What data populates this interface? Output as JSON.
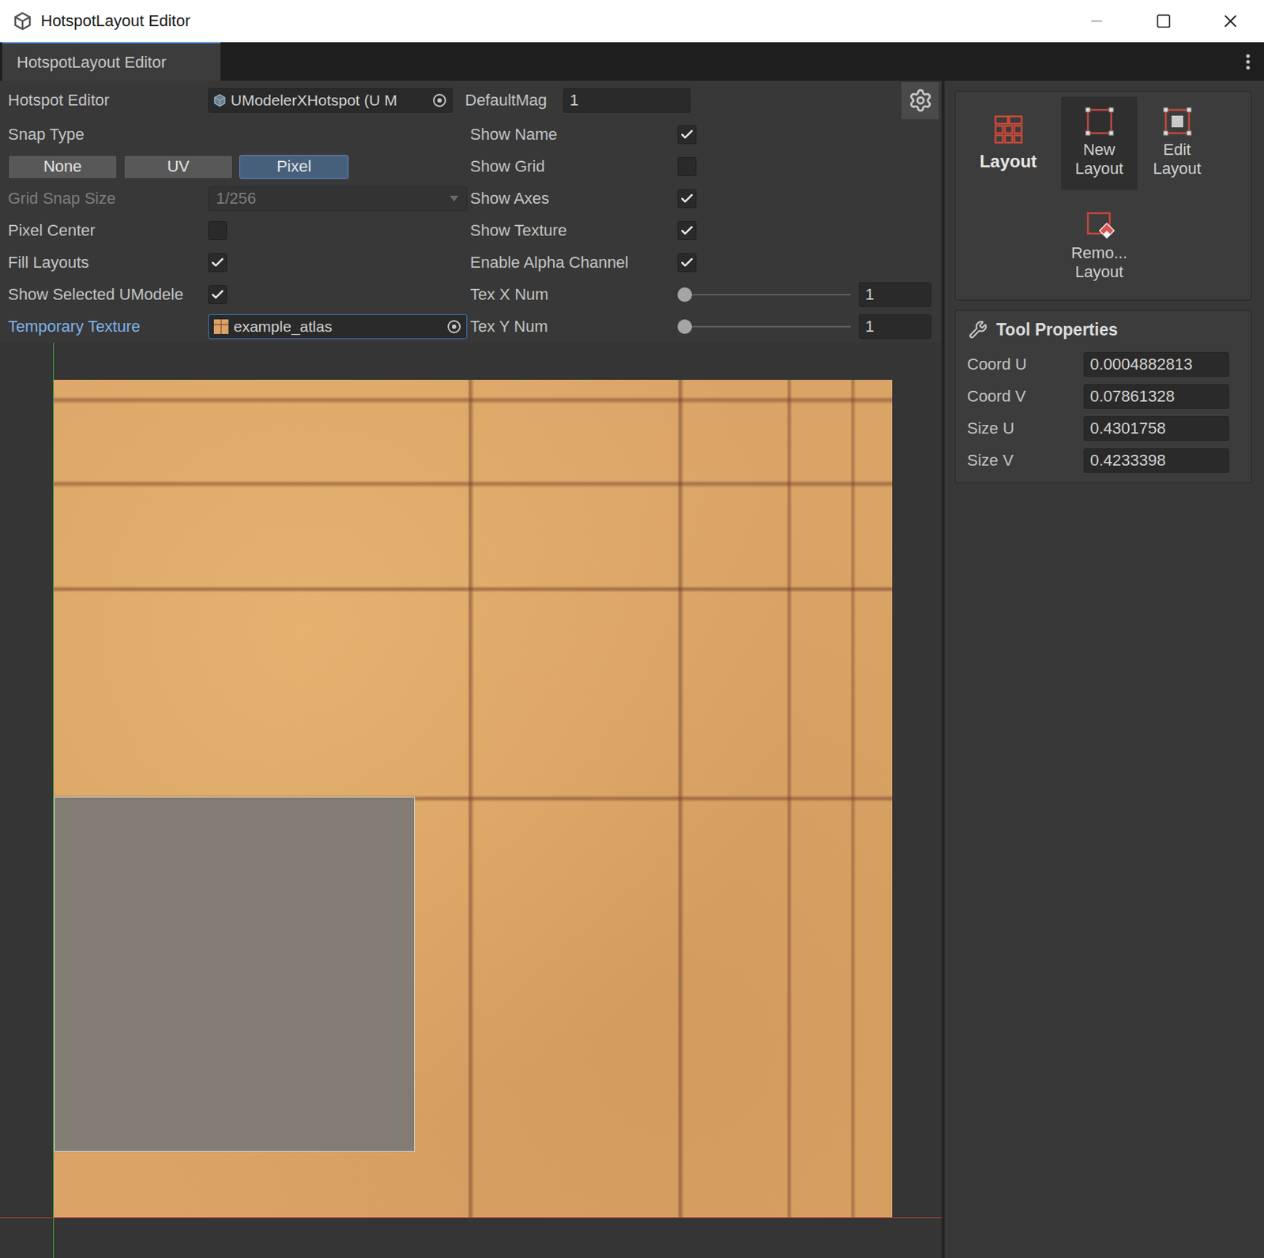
{
  "window": {
    "title": "HotspotLayout Editor"
  },
  "tabs": [
    {
      "label": "HotspotLayout Editor",
      "selected": true
    }
  ],
  "header": {
    "hotspot_editor": {
      "label": "Hotspot Editor",
      "value": "UModelerXHotspot (U M"
    },
    "default_mag": {
      "label": "DefaultMag",
      "value": "1"
    }
  },
  "snap_type": {
    "label": "Snap Type",
    "options": [
      {
        "label": "None",
        "selected": false
      },
      {
        "label": "UV",
        "selected": false
      },
      {
        "label": "Pixel",
        "selected": true
      }
    ]
  },
  "left_rows": [
    {
      "kind": "dropdown",
      "label": "Grid Snap Size",
      "value": "1/256",
      "disabled": true
    },
    {
      "kind": "checkbox",
      "label": "Pixel Center",
      "checked": false
    },
    {
      "kind": "checkbox",
      "label": "Fill Layouts",
      "checked": true
    },
    {
      "kind": "checkbox",
      "label": "Show Selected UModele",
      "checked": true
    },
    {
      "kind": "object",
      "label": "Temporary Texture",
      "value": "example_atlas",
      "highlighted": true
    }
  ],
  "right_rows": [
    {
      "kind": "checkbox",
      "label": "Show Name",
      "checked": true
    },
    {
      "kind": "checkbox",
      "label": "Show Grid",
      "checked": false
    },
    {
      "kind": "checkbox",
      "label": "Show Axes",
      "checked": true
    },
    {
      "kind": "checkbox",
      "label": "Show Texture",
      "checked": true
    },
    {
      "kind": "checkbox",
      "label": "Enable Alpha Channel",
      "checked": true
    },
    {
      "kind": "slider",
      "label": "Tex X Num",
      "level": 0,
      "value": "1"
    },
    {
      "kind": "slider",
      "label": "Tex Y Num",
      "level": 0,
      "value": "1"
    }
  ],
  "toolbox": {
    "title": "Layout",
    "tools": [
      {
        "kind": "new",
        "lines": [
          "New",
          "Layout"
        ],
        "selected": true
      },
      {
        "kind": "edit",
        "lines": [
          "Edit",
          "Layout"
        ],
        "selected": false
      },
      {
        "kind": "remove",
        "lines": [
          "Remo...",
          "Layout"
        ],
        "selected": false
      }
    ]
  },
  "tool_properties": {
    "title": "Tool Properties",
    "fields": [
      {
        "label": "Coord U",
        "value": "0.0004882813"
      },
      {
        "label": "Coord V",
        "value": "0.07861328"
      },
      {
        "label": "Size U",
        "value": "0.4301758"
      },
      {
        "label": "Size V",
        "value": "0.4233398"
      }
    ]
  }
}
